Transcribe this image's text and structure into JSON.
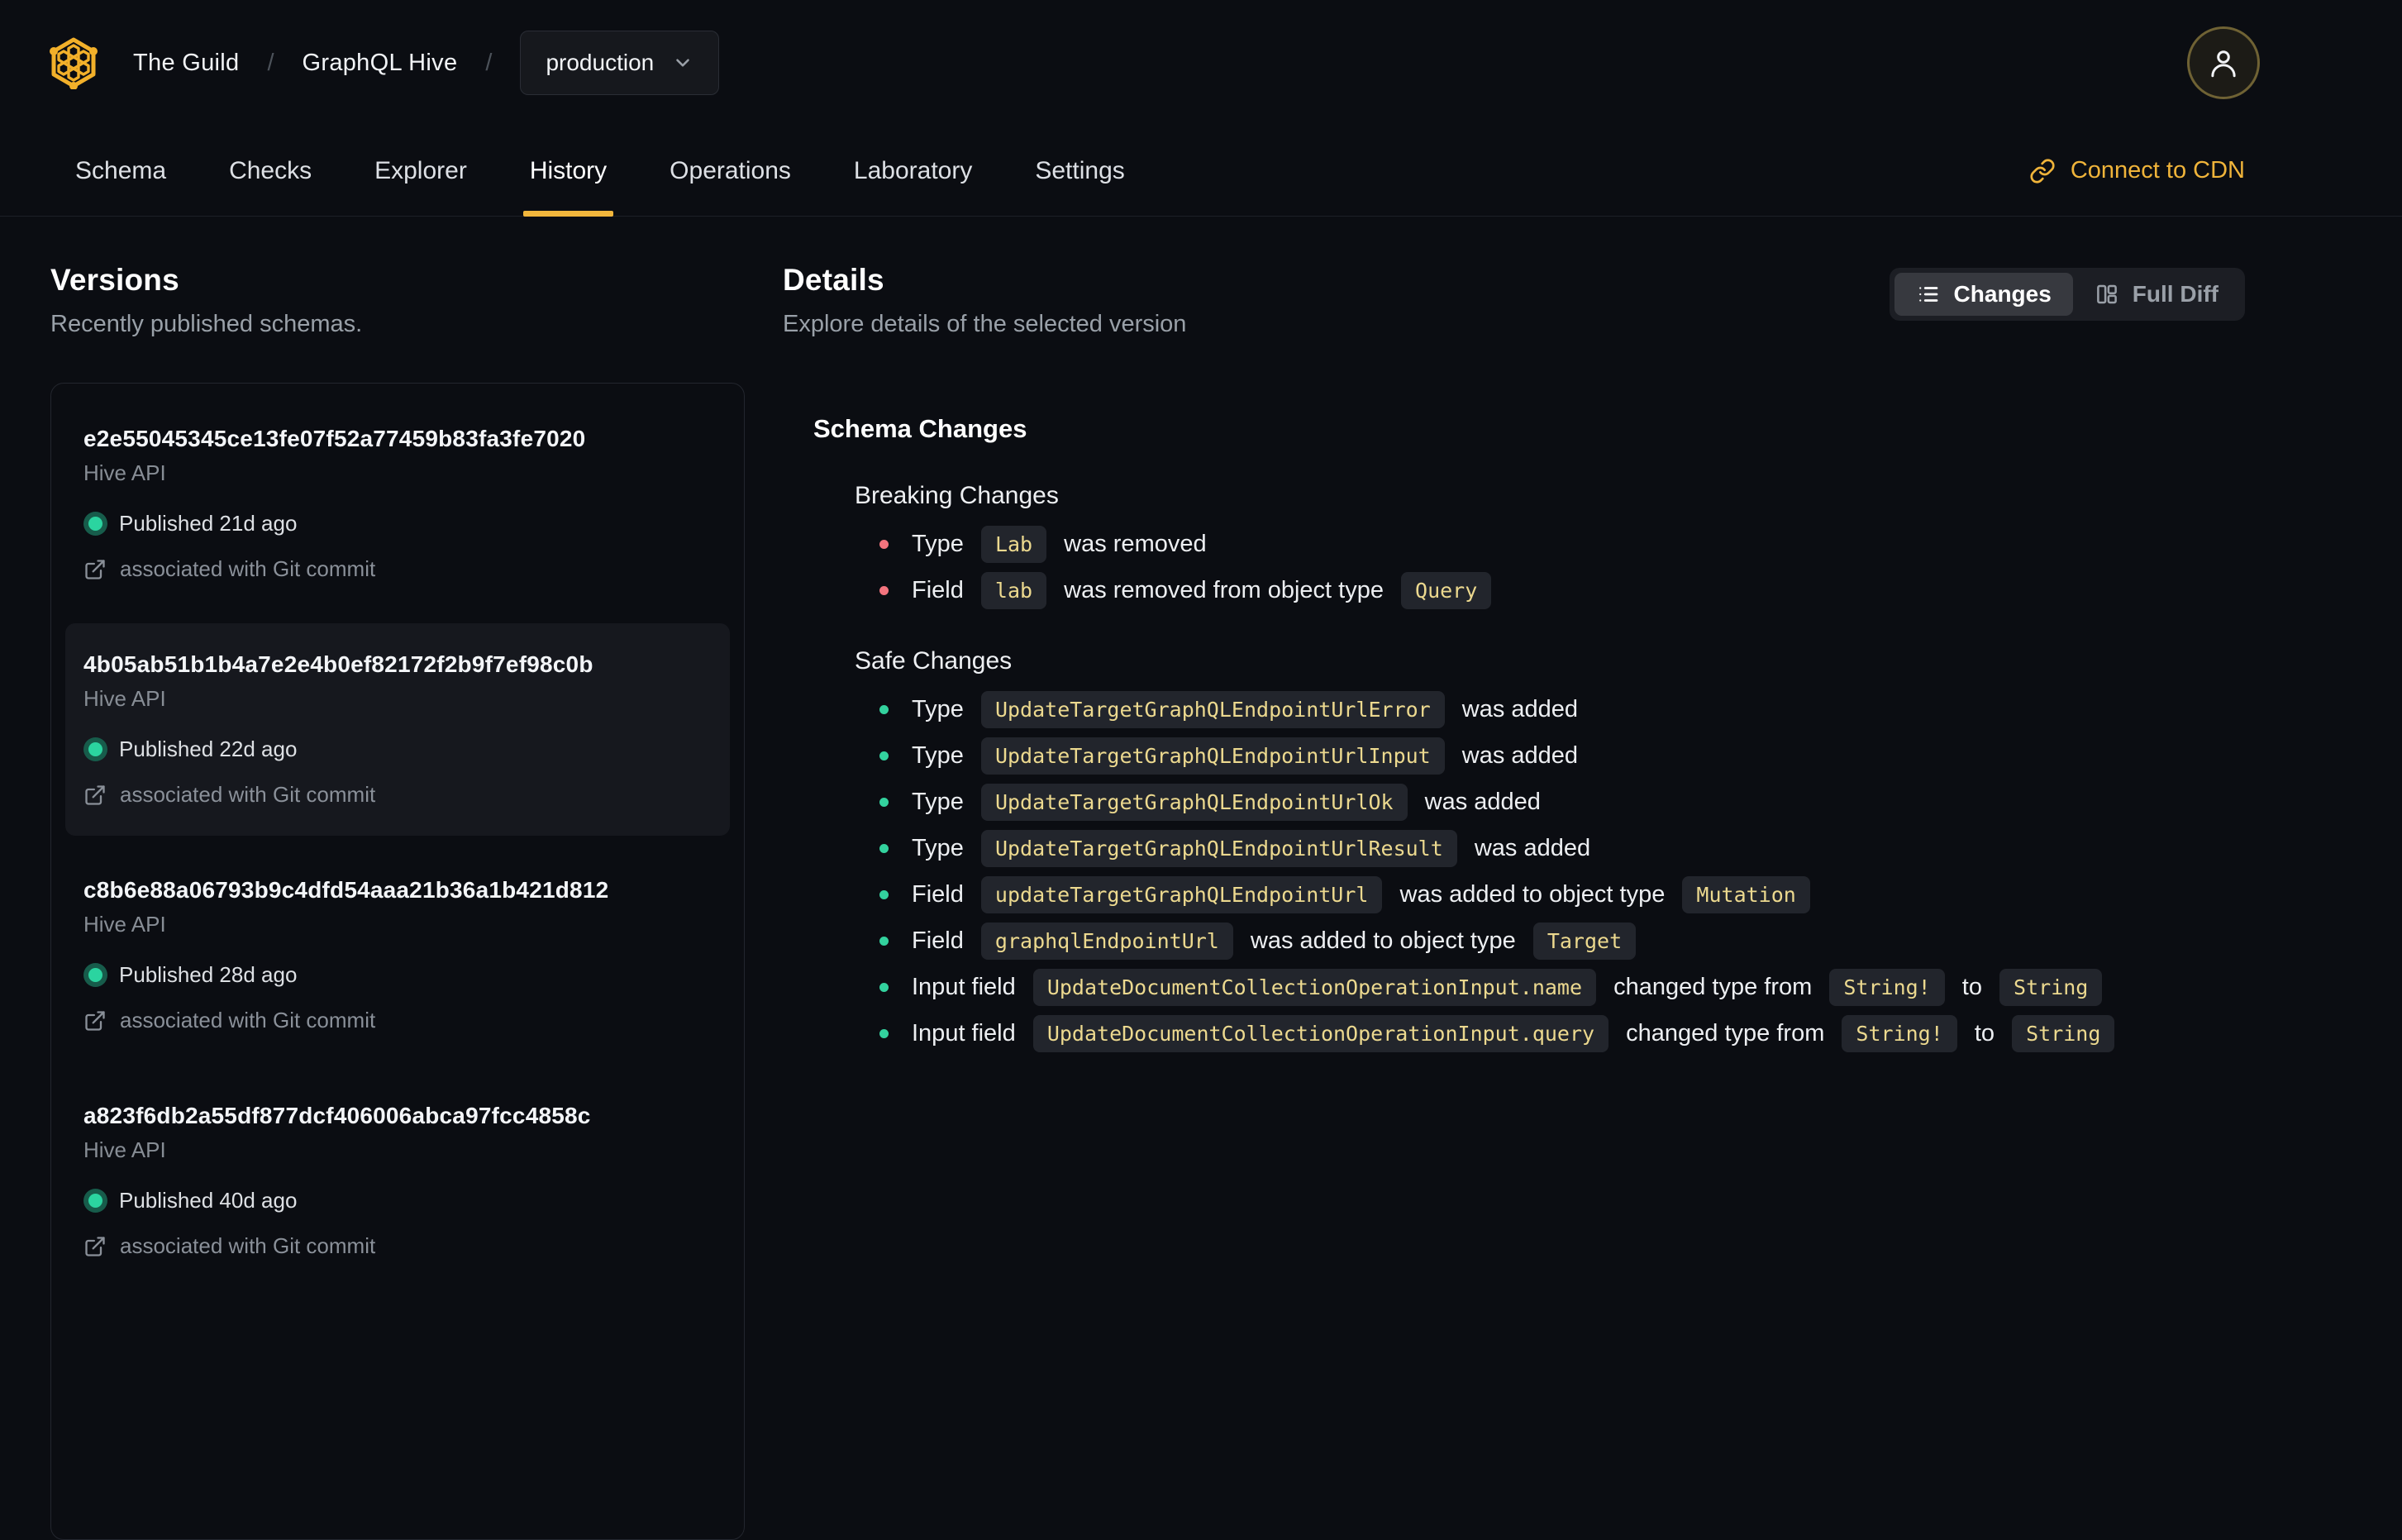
{
  "header": {
    "breadcrumb": {
      "org": "The Guild",
      "separator": "/",
      "project": "GraphQL Hive",
      "target": "production"
    },
    "tabs": [
      {
        "label": "Schema"
      },
      {
        "label": "Checks"
      },
      {
        "label": "Explorer"
      },
      {
        "label": "History"
      },
      {
        "label": "Operations"
      },
      {
        "label": "Laboratory"
      },
      {
        "label": "Settings"
      }
    ],
    "active_tab": "History",
    "connect_cdn_label": "Connect to CDN"
  },
  "versions_panel": {
    "title": "Versions",
    "subtitle": "Recently published schemas.",
    "items": [
      {
        "hash": "e2e55045345ce13fe07f52a77459b83fa3fe7020",
        "service": "Hive API",
        "status": "Published 21d ago",
        "git": "associated with Git commit",
        "selected": false
      },
      {
        "hash": "4b05ab51b1b4a7e2e4b0ef82172f2b9f7ef98c0b",
        "service": "Hive API",
        "status": "Published 22d ago",
        "git": "associated with Git commit",
        "selected": true
      },
      {
        "hash": "c8b6e88a06793b9c4dfd54aaa21b36a1b421d812",
        "service": "Hive API",
        "status": "Published 28d ago",
        "git": "associated with Git commit",
        "selected": false
      },
      {
        "hash": "a823f6db2a55df877dcf406006abca97fcc4858c",
        "service": "Hive API",
        "status": "Published 40d ago",
        "git": "associated with Git commit",
        "selected": false
      }
    ]
  },
  "details_panel": {
    "title": "Details",
    "subtitle": "Explore details of the selected version",
    "view_toggle": {
      "changes": "Changes",
      "full_diff": "Full Diff",
      "active": "Changes"
    },
    "section_title": "Schema Changes",
    "breaking": {
      "title": "Breaking Changes",
      "items": [
        {
          "segments": [
            "Type ",
            "Lab",
            " was removed"
          ]
        },
        {
          "segments": [
            "Field ",
            "lab",
            " was removed from object type ",
            "Query"
          ]
        }
      ]
    },
    "safe": {
      "title": "Safe Changes",
      "items": [
        {
          "segments": [
            "Type ",
            "UpdateTargetGraphQLEndpointUrlError",
            " was added"
          ]
        },
        {
          "segments": [
            "Type ",
            "UpdateTargetGraphQLEndpointUrlInput",
            " was added"
          ]
        },
        {
          "segments": [
            "Type ",
            "UpdateTargetGraphQLEndpointUrlOk",
            " was added"
          ]
        },
        {
          "segments": [
            "Type ",
            "UpdateTargetGraphQLEndpointUrlResult",
            " was added"
          ]
        },
        {
          "segments": [
            "Field ",
            "updateTargetGraphQLEndpointUrl",
            " was added to object type ",
            "Mutation"
          ]
        },
        {
          "segments": [
            "Field ",
            "graphqlEndpointUrl",
            " was added to object type ",
            "Target"
          ]
        },
        {
          "segments": [
            "Input field ",
            "UpdateDocumentCollectionOperationInput.name",
            " changed type from ",
            "String!",
            " to ",
            "String"
          ]
        },
        {
          "segments": [
            "Input field ",
            "UpdateDocumentCollectionOperationInput.query",
            " changed type from ",
            "String!",
            " to ",
            "String"
          ]
        }
      ]
    }
  },
  "icons": {
    "hive-logo-icon": "yellow hexagon with honeycomb",
    "chevron-down-icon": "▾",
    "user-icon": "person outline",
    "link-icon": "chain link",
    "list-icon": "bulleted list",
    "columns-icon": "split panels",
    "external-link-icon": "box with arrow",
    "status-dot-icon": "green circle"
  },
  "colors": {
    "background": "#0b0d12",
    "accent_amber": "#f2b63c",
    "breaking_bullet": "#f4747e",
    "safe_bullet": "#33d29e",
    "code_text": "#ecd98f",
    "code_background": "#22252c",
    "status_green": "#2bd4a0"
  }
}
